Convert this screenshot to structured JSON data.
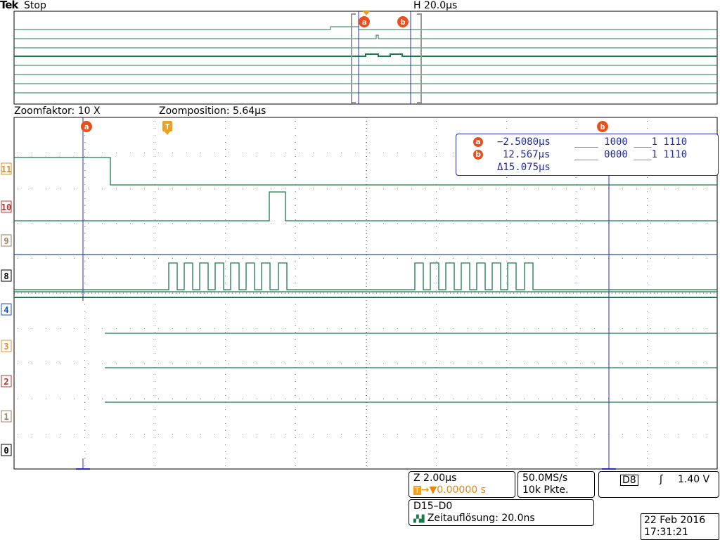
{
  "header": {
    "logo": "Tek",
    "status": "Stop",
    "horizontal_scale": "H 20.0µs"
  },
  "zoom": {
    "factor": "Zoomfaktor: 10 X",
    "position": "Zoomposition: 5.64µs"
  },
  "markers": {
    "cursor_a": "a",
    "cursor_b": "b",
    "trigger": "T"
  },
  "channels": [
    "11",
    "10",
    "9",
    "8",
    "4",
    "3",
    "2",
    "1",
    "0"
  ],
  "cursor_readout": {
    "a_time": "−2.5080µs",
    "a_bits": "____ 1000 ___1 1110",
    "b_time": "12.567µs",
    "b_bits": "____ 0000 ___1 1110",
    "delta": "Δ15.075µs"
  },
  "bottom": {
    "zoom_scale": "Z 2.00µs",
    "trigger_offset": "0.00000 s",
    "sample_rate": "50.0MS/s",
    "record_length": "10k Pkte.",
    "trig_source": "D8",
    "trig_level": "1.40 V",
    "bus_name": "D15–D0",
    "time_resolution": "Zeitauflösung: 20.0ns",
    "date": "22 Feb  2016",
    "time": "17:31:21"
  },
  "colors": {
    "trace": "#1a7a4a",
    "cursor": "#2a2ad0",
    "marker": "#e8501e",
    "trigger": "#f0a020"
  }
}
